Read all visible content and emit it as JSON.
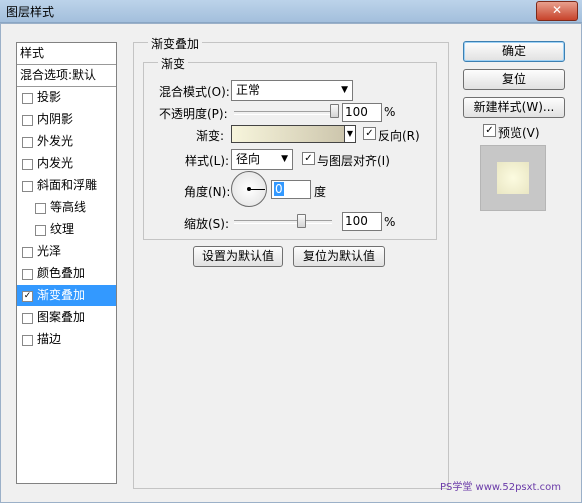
{
  "window": {
    "title": "图层样式",
    "close_label": "✕"
  },
  "sidebar": {
    "header": "样式",
    "blend_options": "混合选项:默认",
    "items": [
      {
        "label": "投影",
        "checked": false,
        "indent": false
      },
      {
        "label": "内阴影",
        "checked": false,
        "indent": false
      },
      {
        "label": "外发光",
        "checked": false,
        "indent": false
      },
      {
        "label": "内发光",
        "checked": false,
        "indent": false
      },
      {
        "label": "斜面和浮雕",
        "checked": false,
        "indent": false
      },
      {
        "label": "等高线",
        "checked": false,
        "indent": true
      },
      {
        "label": "纹理",
        "checked": false,
        "indent": true
      },
      {
        "label": "光泽",
        "checked": false,
        "indent": false
      },
      {
        "label": "颜色叠加",
        "checked": false,
        "indent": false
      },
      {
        "label": "渐变叠加",
        "checked": true,
        "indent": false,
        "selected": true
      },
      {
        "label": "图案叠加",
        "checked": false,
        "indent": false
      },
      {
        "label": "描边",
        "checked": false,
        "indent": false
      }
    ]
  },
  "panel": {
    "group_title": "渐变叠加",
    "subgroup_title": "渐变",
    "blend_mode_label": "混合模式(O):",
    "blend_mode_value": "正常",
    "opacity_label": "不透明度(P):",
    "opacity_value": "100",
    "opacity_unit": "%",
    "opacity_fraction": 1.0,
    "gradient_label": "渐变:",
    "gradient_colors": [
      "#f7f5dc",
      "#cdc6ad"
    ],
    "reverse_label": "反向(R)",
    "reverse_checked": true,
    "style_label": "样式(L):",
    "style_value": "径向",
    "align_label": "与图层对齐(I)",
    "align_checked": true,
    "angle_label": "角度(N):",
    "angle_value": "0",
    "angle_unit": "度",
    "scale_label": "缩放(S):",
    "scale_value": "100",
    "scale_unit": "%",
    "scale_fraction": 0.66,
    "set_default_button": "设置为默认值",
    "reset_default_button": "复位为默认值"
  },
  "actions": {
    "ok": "确定",
    "reset": "复位",
    "new_style": "新建样式(W)...",
    "preview_label": "预览(V)",
    "preview_checked": true
  },
  "watermark": "PS学堂 www.52psxt.com",
  "check_mark": "✓",
  "dropdown_arrow": "▼"
}
